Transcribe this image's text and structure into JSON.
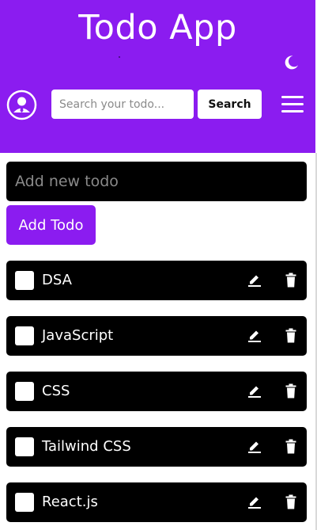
{
  "header": {
    "title": "Todo App",
    "search": {
      "placeholder": "Search your todo...",
      "value": ""
    },
    "search_label": "Search",
    "icons": {
      "theme_toggle": "moon-icon",
      "profile": "user-avatar-icon",
      "menu": "hamburger-menu-icon"
    }
  },
  "new_todo": {
    "placeholder": "Add new todo",
    "value": "",
    "add_label": "Add Todo"
  },
  "todos": [
    {
      "text": "DSA",
      "completed": false
    },
    {
      "text": "JavaScript",
      "completed": false
    },
    {
      "text": "CSS",
      "completed": false
    },
    {
      "text": "Tailwind CSS",
      "completed": false
    },
    {
      "text": "React.js",
      "completed": false
    }
  ],
  "colors": {
    "accent": "#8b1cf0",
    "item_background": "#000000",
    "text_light": "#ffffff"
  }
}
